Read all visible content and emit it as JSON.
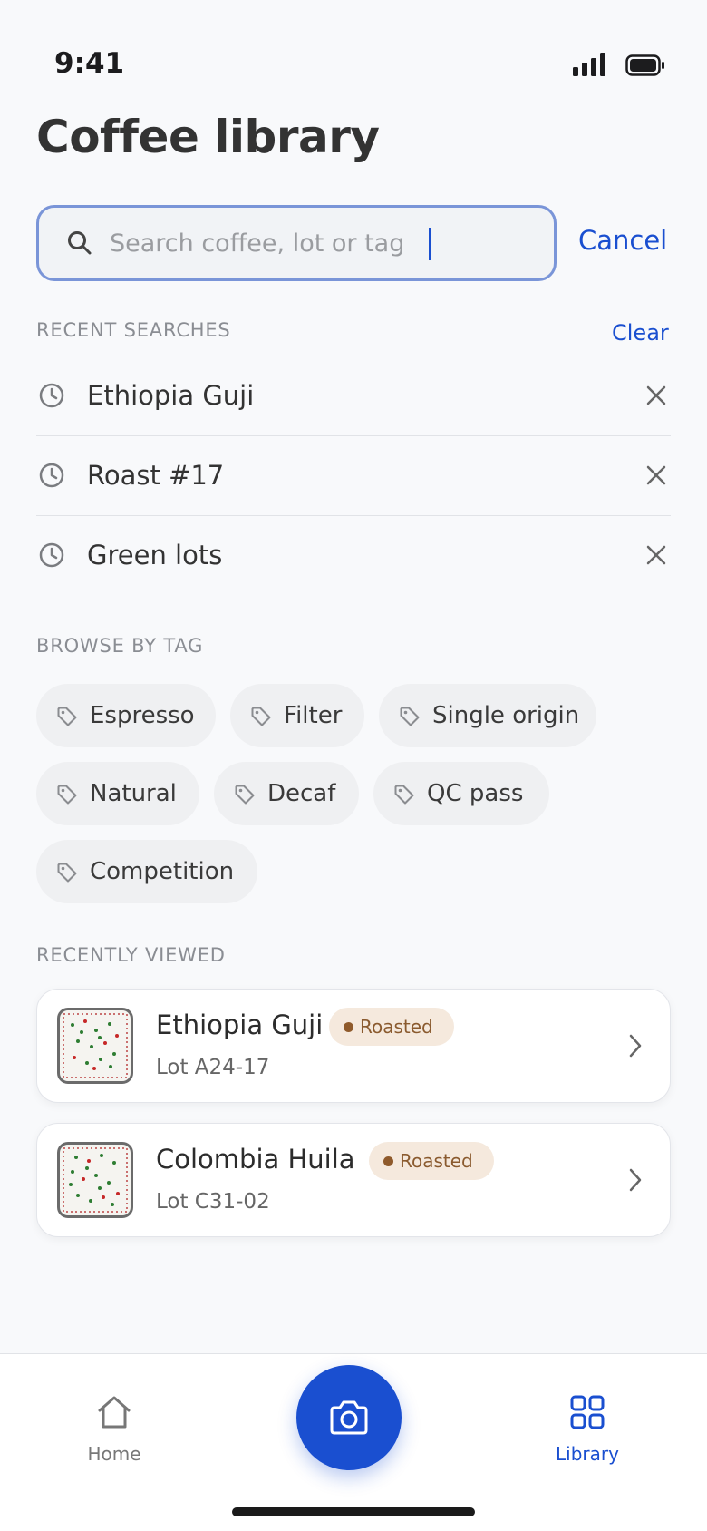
{
  "status_bar": {
    "time": "9:41"
  },
  "header": {
    "title": "Coffee library"
  },
  "search": {
    "placeholder": "Search coffee, lot or tag",
    "value": "",
    "cancel_label": "Cancel"
  },
  "recent_searches": {
    "label": "RECENT SEARCHES",
    "clear_label": "Clear",
    "items": [
      {
        "label": "Ethiopia Guji"
      },
      {
        "label": "Roast #17"
      },
      {
        "label": "Green lots"
      }
    ]
  },
  "browse_by_tag": {
    "label": "BROWSE BY TAG",
    "tags": [
      {
        "label": "Espresso"
      },
      {
        "label": "Filter"
      },
      {
        "label": "Single origin"
      },
      {
        "label": "Natural"
      },
      {
        "label": "Decaf"
      },
      {
        "label": "QC pass"
      },
      {
        "label": "Competition"
      }
    ]
  },
  "recently_viewed": {
    "label": "RECENTLY VIEWED",
    "items": [
      {
        "name": "Ethiopia Guji",
        "status": "Roasted",
        "lot": "Lot A24-17"
      },
      {
        "name": "Colombia Huila",
        "status": "Roasted",
        "lot": "Lot C31-02"
      }
    ]
  },
  "tab_bar": {
    "home_label": "Home",
    "library_label": "Library"
  },
  "colors": {
    "accent": "#1a4fd0",
    "badge_bg": "#f5e9dd",
    "badge_text": "#8a5a2e",
    "search_border": "#7a95d8"
  }
}
